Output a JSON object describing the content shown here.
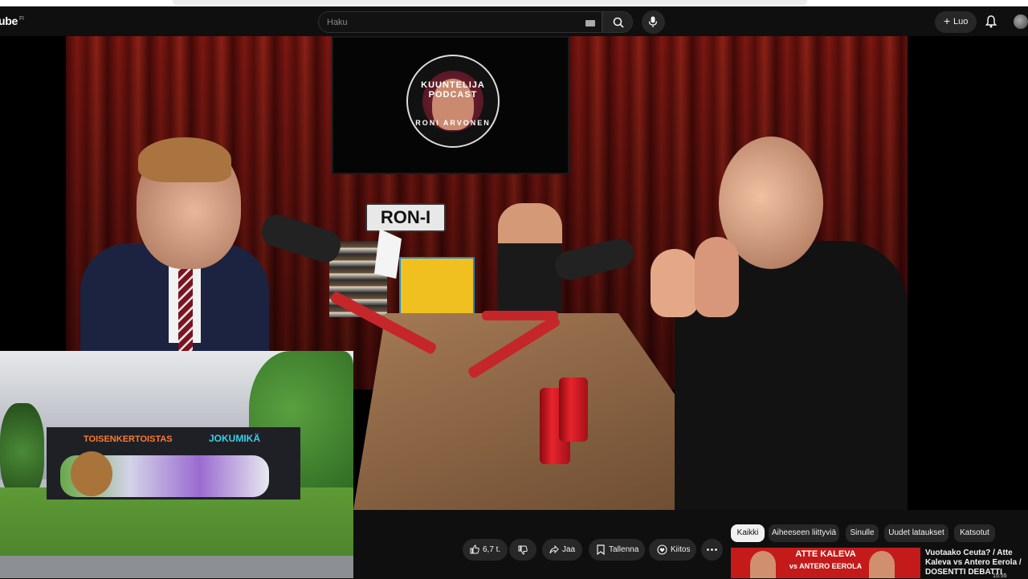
{
  "masthead": {
    "logo_text": "ube",
    "country_code": "FI",
    "search_placeholder": "Haku",
    "create_label": "Luo"
  },
  "video_content": {
    "tv_text_top": "KUUNTELIJA PODCAST",
    "tv_text_bottom": "RONI ARVONEN",
    "plate_text": "RON-I",
    "inset_tag_left": "TOISENKERTOISTAS",
    "inset_tag_right": "JOKUMIKÄ"
  },
  "actions": {
    "like_count": "6,7 t.",
    "share_label": "Jaa",
    "save_label": "Tallenna",
    "thanks_label": "Kiitos"
  },
  "chips": [
    {
      "label": "Kaikki",
      "active": true
    },
    {
      "label": "Aiheeseen liittyviä",
      "active": false
    },
    {
      "label": "Sinulle",
      "active": false
    },
    {
      "label": "Uudet lataukset",
      "active": false
    },
    {
      "label": "Katsotut",
      "active": false
    }
  ],
  "related": {
    "thumb_line1": "ATTE KALEVA",
    "thumb_line2": "vs ANTERO EEROLA",
    "title": "Vuotaako Ceuta? / Atte Kaleva vs Antero Eerola / DOSENTTI DEBATTI",
    "duration": "15:55"
  },
  "colors": {
    "background": "#0f0f0f",
    "pill": "#272727",
    "chip_active": "#f1f1f1",
    "thumb_red": "#c41a1a"
  }
}
